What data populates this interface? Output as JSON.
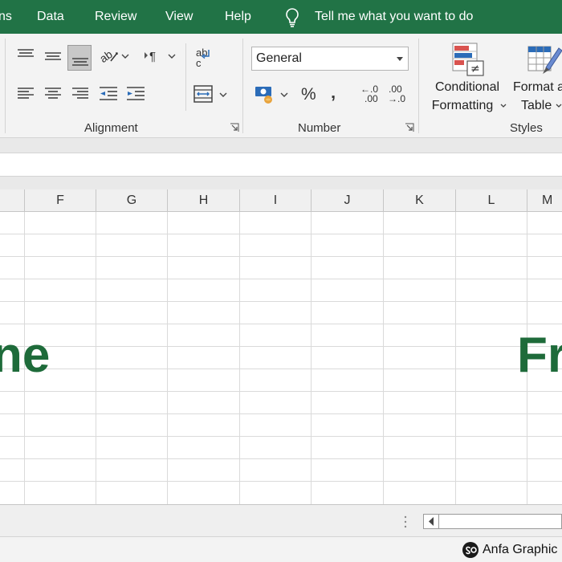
{
  "menubar": {
    "items": [
      "ns",
      "Data",
      "Review",
      "View",
      "Help"
    ],
    "tell_me": "Tell me what you want to do"
  },
  "ribbon": {
    "alignment": {
      "label": "Alignment"
    },
    "number": {
      "label": "Number",
      "format_value": "General"
    },
    "styles": {
      "label": "Styles",
      "conditional_formatting_line1": "Conditional",
      "conditional_formatting_line2": "Formatting",
      "format_as_table_line1": "Format a",
      "format_as_table_line2": "Table"
    },
    "wrap_text_glyph": "ab",
    "wrap_text_glyph2": "c",
    "percent_glyph": "%",
    "comma_glyph": "‚",
    "inc_decimal_top": "←.0",
    "inc_decimal_bottom": ".00",
    "dec_decimal_top": ".00",
    "dec_decimal_bottom": "→.0"
  },
  "grid": {
    "columns": [
      "",
      "F",
      "G",
      "H",
      "I",
      "J",
      "K",
      "L",
      "M"
    ],
    "overlay_left": "ne",
    "overlay_right": "Fr"
  },
  "status": {
    "brand": "Anfa Graphic"
  },
  "colors": {
    "excel_green": "#217346",
    "overlay_green": "#1e6b3a"
  }
}
